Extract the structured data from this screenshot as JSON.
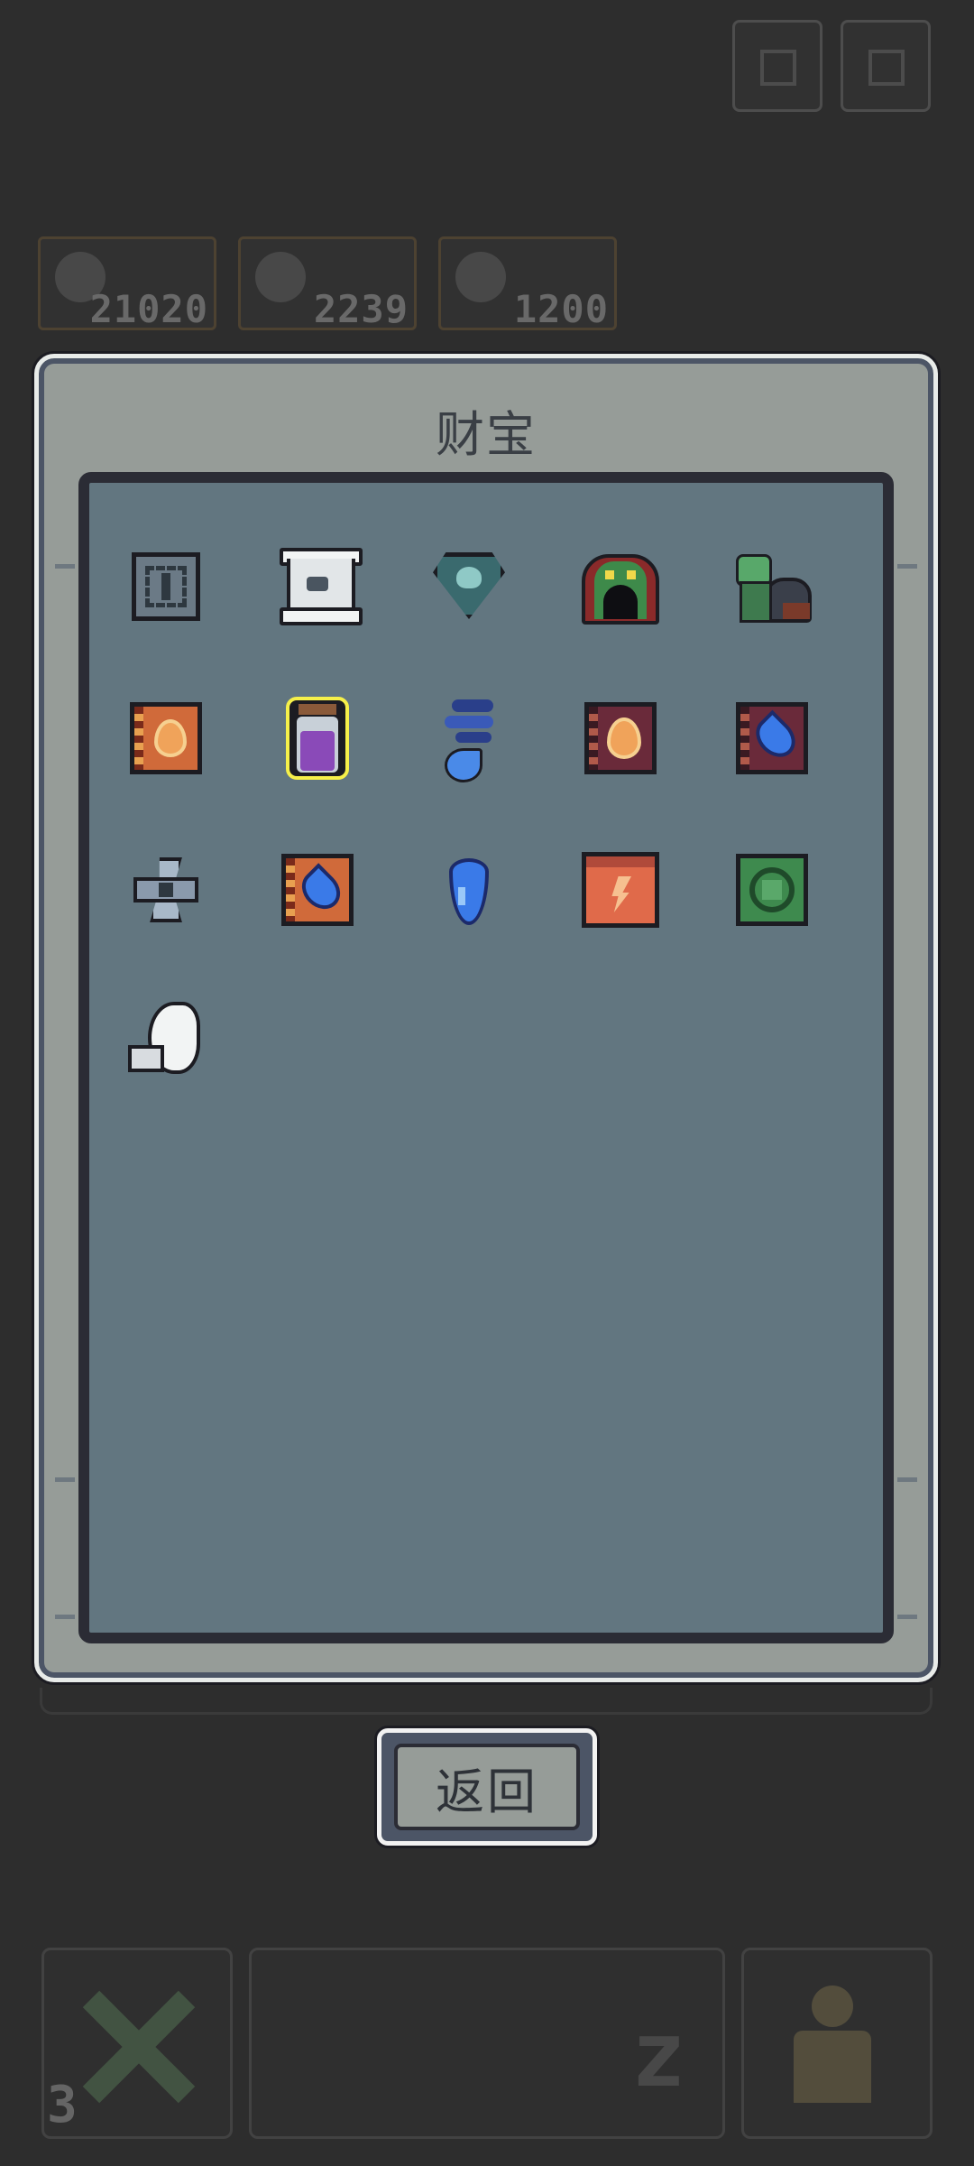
{
  "hud": {
    "resources": [
      {
        "icon": "resource-icon",
        "value": "21020"
      },
      {
        "icon": "resource-icon",
        "value": "2239"
      },
      {
        "icon": "resource-icon",
        "value": "1200"
      }
    ],
    "bottom_count": "3"
  },
  "modal": {
    "title": "财宝",
    "items": [
      {
        "name": "stone-block-icon"
      },
      {
        "name": "scroll-icon"
      },
      {
        "name": "heart-gem-icon"
      },
      {
        "name": "monster-hood-icon"
      },
      {
        "name": "goblin-sack-icon"
      },
      {
        "name": "fire-tome-icon"
      },
      {
        "name": "potion-jar-icon"
      },
      {
        "name": "wind-spirit-icon"
      },
      {
        "name": "fire-book-icon"
      },
      {
        "name": "water-book-icon"
      },
      {
        "name": "shuriken-icon"
      },
      {
        "name": "water-tome-icon"
      },
      {
        "name": "water-drop-icon"
      },
      {
        "name": "lightning-chest-icon"
      },
      {
        "name": "leaf-rune-icon"
      },
      {
        "name": "moon-feather-icon"
      }
    ]
  },
  "back_label": "返回"
}
